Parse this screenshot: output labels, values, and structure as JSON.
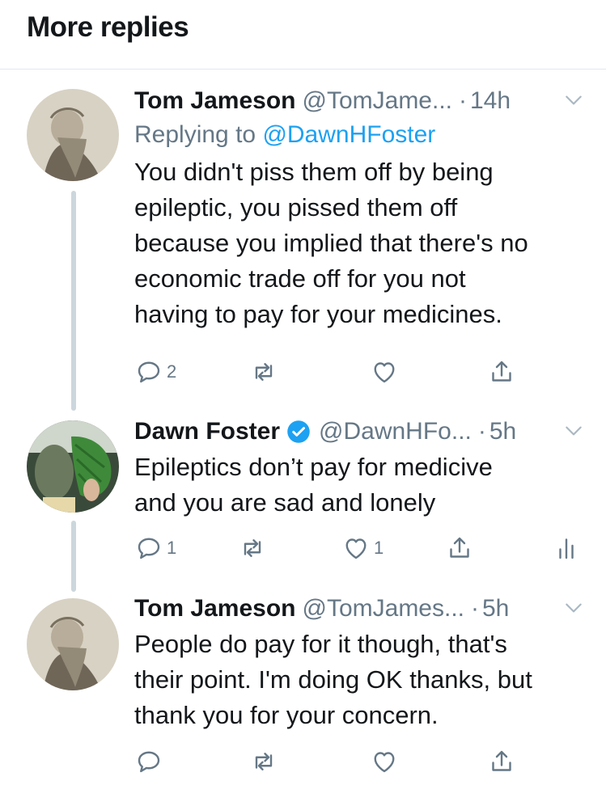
{
  "header": {
    "title": "More replies"
  },
  "tweets": [
    {
      "name": "Tom Jameson",
      "handle": "@TomJame...",
      "time_sep": "·",
      "time": "14h",
      "replying_prefix": "Replying to ",
      "replying_handle": "@DawnHFoster",
      "lines": [
        "You didn't piss them off by being",
        "epileptic, you pissed them off",
        "because you implied that there's no",
        "economic trade off for you not",
        "having to pay for your medicines."
      ],
      "reply_count": "2",
      "retweet_count": "",
      "like_count": ""
    },
    {
      "name": "Dawn Foster",
      "verified": true,
      "handle": "@DawnHFo...",
      "time_sep": "·",
      "time": "5h",
      "lines": [
        "Epileptics don’t pay for medicive",
        "and you are sad and lonely"
      ],
      "reply_count": "1",
      "retweet_count": "",
      "like_count": "1"
    },
    {
      "name": "Tom Jameson",
      "handle": "@TomJames...",
      "time_sep": "·",
      "time": "5h",
      "lines": [
        "People do pay for it though, that's",
        "their point. I'm doing OK thanks, but",
        "thank you for your concern."
      ],
      "reply_count": "",
      "retweet_count": "",
      "like_count": ""
    }
  ],
  "icons": {
    "reply": "reply-icon",
    "retweet": "retweet-icon",
    "like": "heart-icon",
    "share": "share-icon",
    "analytics": "analytics-icon",
    "more": "chevron-down-icon",
    "verified": "verified-badge-icon"
  },
  "colors": {
    "link": "#1da1f2",
    "secondary": "#657786",
    "thread_line": "#ccd6dd",
    "divider": "#e1e8ed"
  }
}
